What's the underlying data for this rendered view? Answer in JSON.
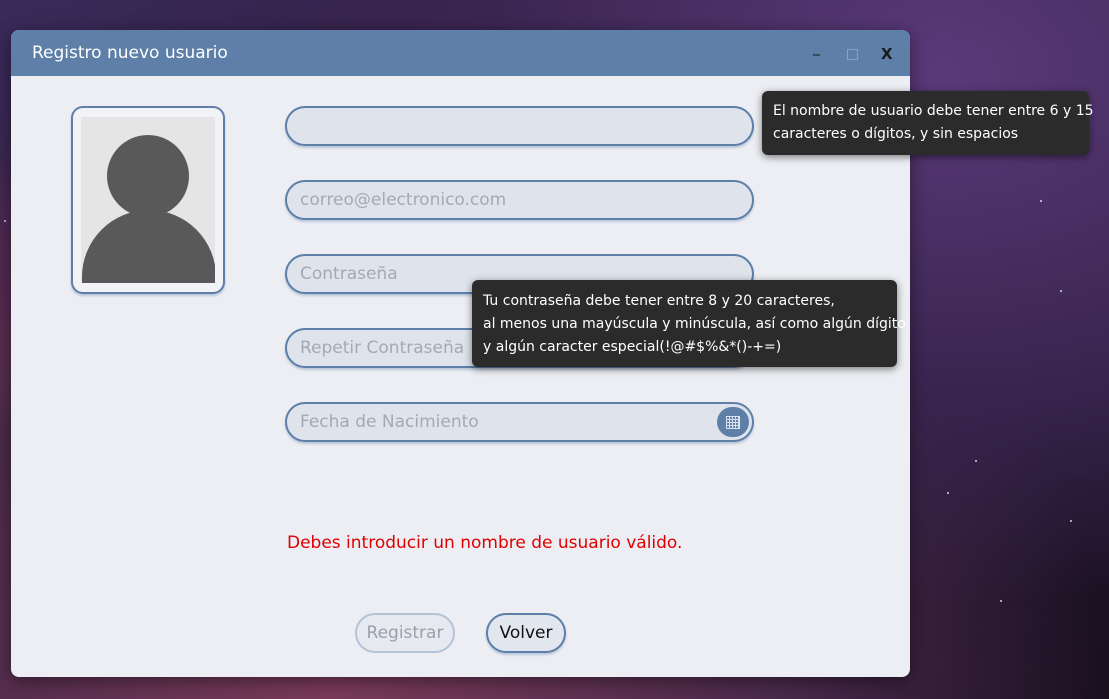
{
  "window": {
    "title": "Registro nuevo usuario",
    "controls": {
      "minimize": "_",
      "maximize": "□",
      "close": "X"
    }
  },
  "form": {
    "username": {
      "value": "",
      "placeholder": ""
    },
    "email": {
      "placeholder": "correo@electronico.com"
    },
    "password": {
      "placeholder": "Contraseña"
    },
    "repeat_password": {
      "placeholder": "Repetir Contraseña"
    },
    "birth_date": {
      "placeholder": "Fecha de Nacimiento",
      "picker_icon": "calendar-icon"
    }
  },
  "error_message": "Debes introducir un nombre de usuario válido.",
  "buttons": {
    "register": "Registrar",
    "back": "Volver"
  },
  "tooltips": {
    "username": [
      "El nombre de usuario debe tener entre 6 y 15",
      "caracteres o dígitos, y sin espacios"
    ],
    "password": [
      "Tu contraseña debe tener entre 8 y 20 caracteres,",
      "al menos una mayúscula y minúscula, así como algún dígito",
      "y algún caracter especial(!@#$%&*()-+=)"
    ]
  },
  "colors": {
    "accent": "#5d7fa8",
    "error": "#e00000",
    "tooltip_bg": "#2b2b2b"
  }
}
